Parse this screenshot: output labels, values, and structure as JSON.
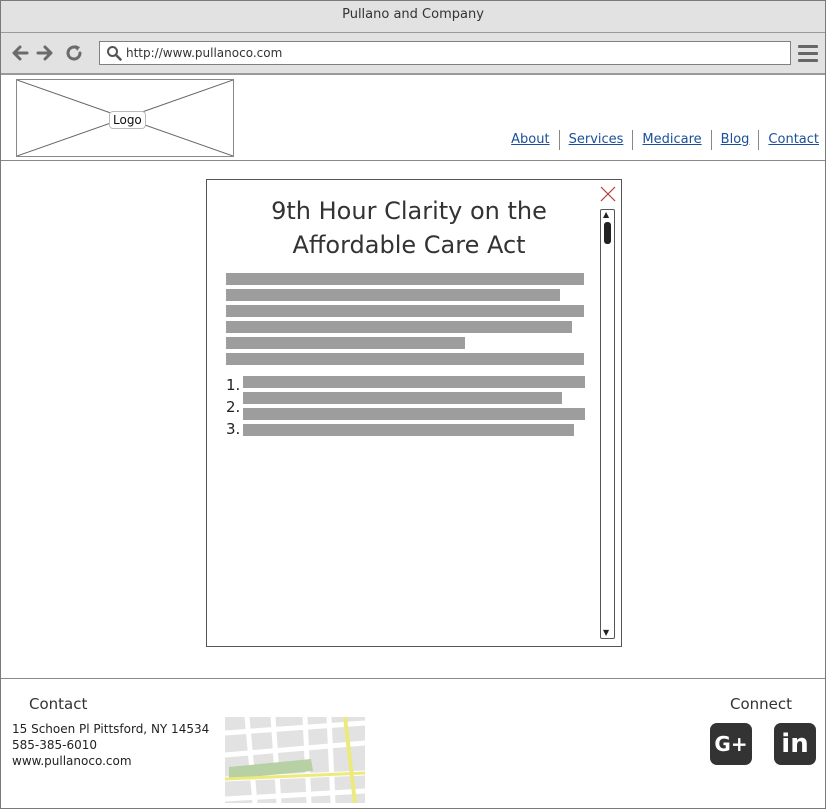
{
  "window": {
    "title": "Pullano and Company"
  },
  "browser": {
    "url": "http://www.pullanoco.com",
    "back_icon": "arrow-left-icon",
    "forward_icon": "arrow-right-icon",
    "reload_icon": "reload-icon",
    "menu_icon": "hamburger-menu-icon"
  },
  "header": {
    "logo_label": "Logo",
    "nav": [
      {
        "label": "About"
      },
      {
        "label": "Services"
      },
      {
        "label": "Medicare"
      },
      {
        "label": "Blog"
      },
      {
        "label": "Contact"
      }
    ]
  },
  "modal": {
    "title_line1": "9th Hour Clarity on the",
    "title_line2": "Affordable Care Act",
    "list_numbers": [
      "1.",
      "2.",
      "3."
    ],
    "close_color": "#b33a3a"
  },
  "footer": {
    "contact_heading": "Contact",
    "address": "15 Schoen Pl Pittsford, NY 14534",
    "phone": "585-385-6010",
    "website": "www.pullanoco.com",
    "connect_heading": "Connect",
    "social": [
      {
        "label": "G+",
        "icon": "google-plus-icon"
      },
      {
        "label": "in",
        "icon": "linkedin-icon"
      }
    ]
  }
}
